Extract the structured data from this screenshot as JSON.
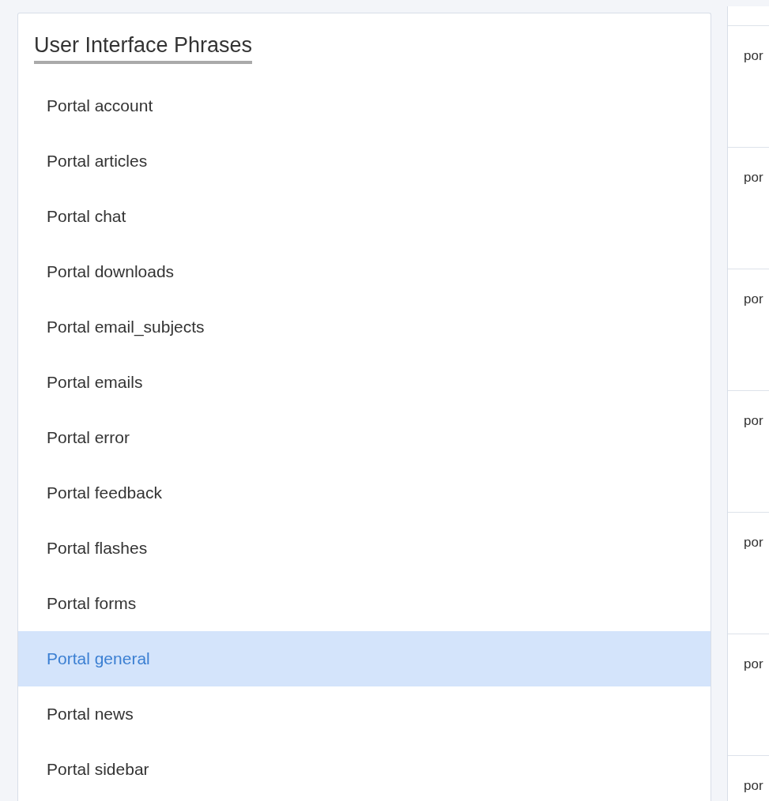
{
  "phrases_panel": {
    "title": "User Interface Phrases",
    "items": [
      {
        "label": "Portal account",
        "selected": false
      },
      {
        "label": "Portal articles",
        "selected": false
      },
      {
        "label": "Portal chat",
        "selected": false
      },
      {
        "label": "Portal downloads",
        "selected": false
      },
      {
        "label": "Portal email_subjects",
        "selected": false
      },
      {
        "label": "Portal emails",
        "selected": false
      },
      {
        "label": "Portal error",
        "selected": false
      },
      {
        "label": "Portal feedback",
        "selected": false
      },
      {
        "label": "Portal flashes",
        "selected": false
      },
      {
        "label": "Portal forms",
        "selected": false
      },
      {
        "label": "Portal general",
        "selected": true
      },
      {
        "label": "Portal news",
        "selected": false
      },
      {
        "label": "Portal sidebar",
        "selected": false
      }
    ]
  },
  "phrase_list": {
    "rows": [
      {
        "column_1": "por"
      },
      {
        "column_1": "por"
      },
      {
        "column_1": "por"
      },
      {
        "column_1": "por"
      },
      {
        "column_1": "por"
      },
      {
        "column_1": "por"
      },
      {
        "column_1": "por"
      }
    ]
  }
}
